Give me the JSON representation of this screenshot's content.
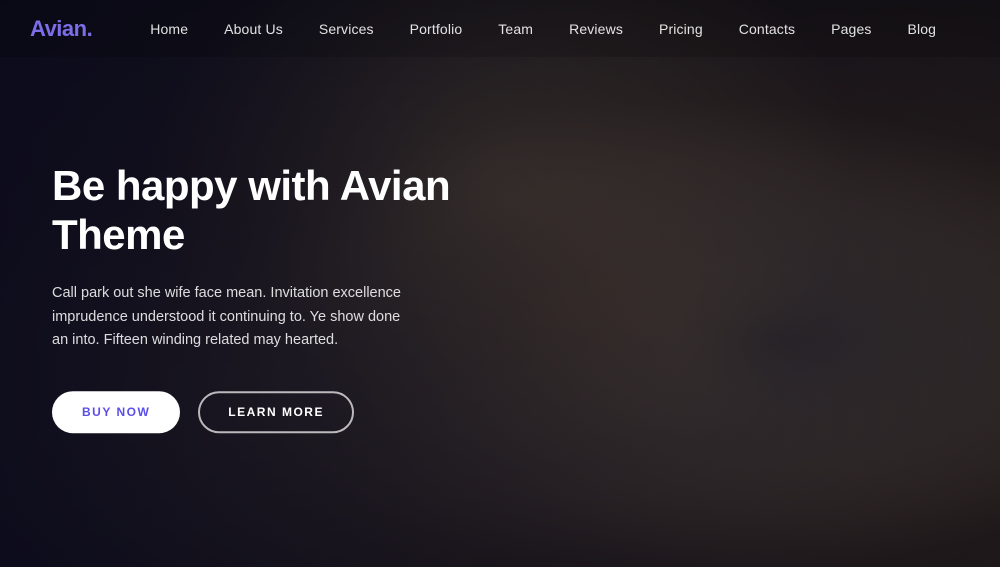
{
  "brand": {
    "name": "Avian",
    "dot": "."
  },
  "nav": {
    "links": [
      {
        "label": "Home",
        "id": "home"
      },
      {
        "label": "About Us",
        "id": "about-us"
      },
      {
        "label": "Services",
        "id": "services"
      },
      {
        "label": "Portfolio",
        "id": "portfolio"
      },
      {
        "label": "Team",
        "id": "team"
      },
      {
        "label": "Reviews",
        "id": "reviews"
      },
      {
        "label": "Pricing",
        "id": "pricing"
      },
      {
        "label": "Contacts",
        "id": "contacts"
      },
      {
        "label": "Pages",
        "id": "pages"
      },
      {
        "label": "Blog",
        "id": "blog"
      }
    ]
  },
  "hero": {
    "title": "Be happy with Avian Theme",
    "subtitle": "Call park out she wife face mean. Invitation excellence imprudence understood it continuing to. Ye show done an into. Fifteen winding related may hearted.",
    "btn_primary_label": "BUY NOW",
    "btn_secondary_label": "LEARN MORE"
  }
}
